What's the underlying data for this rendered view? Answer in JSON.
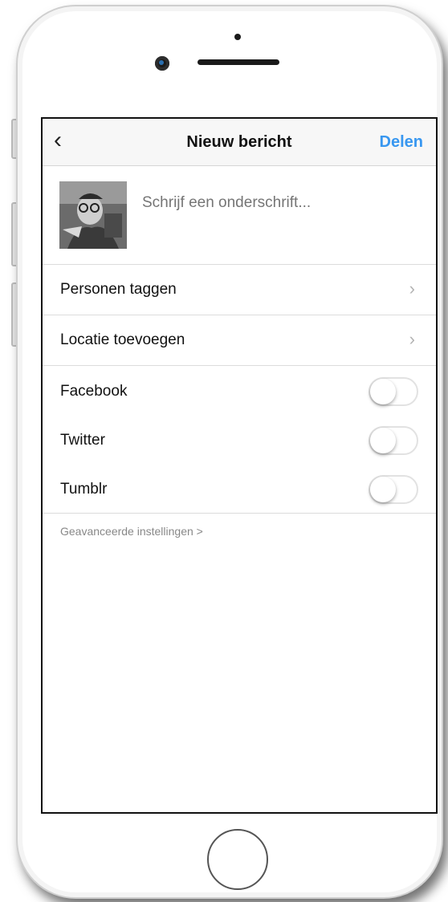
{
  "navbar": {
    "back_icon": "chevron-left-icon",
    "title": "Nieuw bericht",
    "share_label": "Delen"
  },
  "compose": {
    "caption_placeholder": "Schrijf een onderschrift..."
  },
  "options": [
    {
      "label": "Personen taggen",
      "icon": "chevron-right-icon"
    },
    {
      "label": "Locatie toevoegen",
      "icon": "chevron-right-icon"
    }
  ],
  "share_targets": [
    {
      "label": "Facebook",
      "enabled": false
    },
    {
      "label": "Twitter",
      "enabled": false
    },
    {
      "label": "Tumblr",
      "enabled": false
    }
  ],
  "advanced_settings": "Geavanceerde instellingen >",
  "colors": {
    "accent": "#3897f0",
    "separator": "#dcdcdc"
  }
}
